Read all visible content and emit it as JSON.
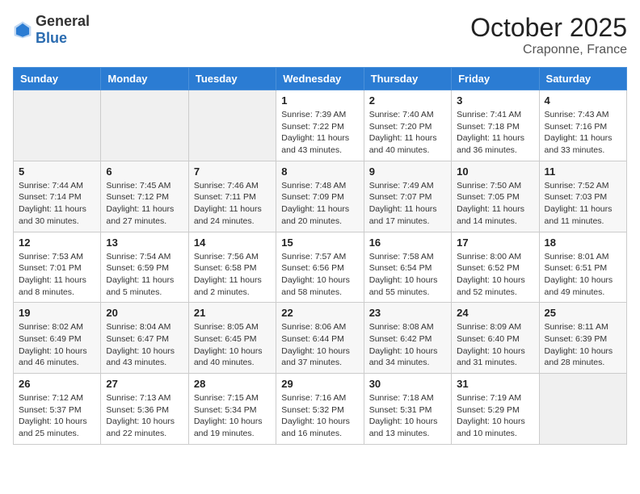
{
  "header": {
    "logo": {
      "general": "General",
      "blue": "Blue"
    },
    "title": "October 2025",
    "location": "Craponne, France"
  },
  "calendar": {
    "days_of_week": [
      "Sunday",
      "Monday",
      "Tuesday",
      "Wednesday",
      "Thursday",
      "Friday",
      "Saturday"
    ],
    "weeks": [
      [
        {
          "day": "",
          "info": ""
        },
        {
          "day": "",
          "info": ""
        },
        {
          "day": "",
          "info": ""
        },
        {
          "day": "1",
          "sunrise": "Sunrise: 7:39 AM",
          "sunset": "Sunset: 7:22 PM",
          "daylight": "Daylight: 11 hours and 43 minutes."
        },
        {
          "day": "2",
          "sunrise": "Sunrise: 7:40 AM",
          "sunset": "Sunset: 7:20 PM",
          "daylight": "Daylight: 11 hours and 40 minutes."
        },
        {
          "day": "3",
          "sunrise": "Sunrise: 7:41 AM",
          "sunset": "Sunset: 7:18 PM",
          "daylight": "Daylight: 11 hours and 36 minutes."
        },
        {
          "day": "4",
          "sunrise": "Sunrise: 7:43 AM",
          "sunset": "Sunset: 7:16 PM",
          "daylight": "Daylight: 11 hours and 33 minutes."
        }
      ],
      [
        {
          "day": "5",
          "sunrise": "Sunrise: 7:44 AM",
          "sunset": "Sunset: 7:14 PM",
          "daylight": "Daylight: 11 hours and 30 minutes."
        },
        {
          "day": "6",
          "sunrise": "Sunrise: 7:45 AM",
          "sunset": "Sunset: 7:12 PM",
          "daylight": "Daylight: 11 hours and 27 minutes."
        },
        {
          "day": "7",
          "sunrise": "Sunrise: 7:46 AM",
          "sunset": "Sunset: 7:11 PM",
          "daylight": "Daylight: 11 hours and 24 minutes."
        },
        {
          "day": "8",
          "sunrise": "Sunrise: 7:48 AM",
          "sunset": "Sunset: 7:09 PM",
          "daylight": "Daylight: 11 hours and 20 minutes."
        },
        {
          "day": "9",
          "sunrise": "Sunrise: 7:49 AM",
          "sunset": "Sunset: 7:07 PM",
          "daylight": "Daylight: 11 hours and 17 minutes."
        },
        {
          "day": "10",
          "sunrise": "Sunrise: 7:50 AM",
          "sunset": "Sunset: 7:05 PM",
          "daylight": "Daylight: 11 hours and 14 minutes."
        },
        {
          "day": "11",
          "sunrise": "Sunrise: 7:52 AM",
          "sunset": "Sunset: 7:03 PM",
          "daylight": "Daylight: 11 hours and 11 minutes."
        }
      ],
      [
        {
          "day": "12",
          "sunrise": "Sunrise: 7:53 AM",
          "sunset": "Sunset: 7:01 PM",
          "daylight": "Daylight: 11 hours and 8 minutes."
        },
        {
          "day": "13",
          "sunrise": "Sunrise: 7:54 AM",
          "sunset": "Sunset: 6:59 PM",
          "daylight": "Daylight: 11 hours and 5 minutes."
        },
        {
          "day": "14",
          "sunrise": "Sunrise: 7:56 AM",
          "sunset": "Sunset: 6:58 PM",
          "daylight": "Daylight: 11 hours and 2 minutes."
        },
        {
          "day": "15",
          "sunrise": "Sunrise: 7:57 AM",
          "sunset": "Sunset: 6:56 PM",
          "daylight": "Daylight: 10 hours and 58 minutes."
        },
        {
          "day": "16",
          "sunrise": "Sunrise: 7:58 AM",
          "sunset": "Sunset: 6:54 PM",
          "daylight": "Daylight: 10 hours and 55 minutes."
        },
        {
          "day": "17",
          "sunrise": "Sunrise: 8:00 AM",
          "sunset": "Sunset: 6:52 PM",
          "daylight": "Daylight: 10 hours and 52 minutes."
        },
        {
          "day": "18",
          "sunrise": "Sunrise: 8:01 AM",
          "sunset": "Sunset: 6:51 PM",
          "daylight": "Daylight: 10 hours and 49 minutes."
        }
      ],
      [
        {
          "day": "19",
          "sunrise": "Sunrise: 8:02 AM",
          "sunset": "Sunset: 6:49 PM",
          "daylight": "Daylight: 10 hours and 46 minutes."
        },
        {
          "day": "20",
          "sunrise": "Sunrise: 8:04 AM",
          "sunset": "Sunset: 6:47 PM",
          "daylight": "Daylight: 10 hours and 43 minutes."
        },
        {
          "day": "21",
          "sunrise": "Sunrise: 8:05 AM",
          "sunset": "Sunset: 6:45 PM",
          "daylight": "Daylight: 10 hours and 40 minutes."
        },
        {
          "day": "22",
          "sunrise": "Sunrise: 8:06 AM",
          "sunset": "Sunset: 6:44 PM",
          "daylight": "Daylight: 10 hours and 37 minutes."
        },
        {
          "day": "23",
          "sunrise": "Sunrise: 8:08 AM",
          "sunset": "Sunset: 6:42 PM",
          "daylight": "Daylight: 10 hours and 34 minutes."
        },
        {
          "day": "24",
          "sunrise": "Sunrise: 8:09 AM",
          "sunset": "Sunset: 6:40 PM",
          "daylight": "Daylight: 10 hours and 31 minutes."
        },
        {
          "day": "25",
          "sunrise": "Sunrise: 8:11 AM",
          "sunset": "Sunset: 6:39 PM",
          "daylight": "Daylight: 10 hours and 28 minutes."
        }
      ],
      [
        {
          "day": "26",
          "sunrise": "Sunrise: 7:12 AM",
          "sunset": "Sunset: 5:37 PM",
          "daylight": "Daylight: 10 hours and 25 minutes."
        },
        {
          "day": "27",
          "sunrise": "Sunrise: 7:13 AM",
          "sunset": "Sunset: 5:36 PM",
          "daylight": "Daylight: 10 hours and 22 minutes."
        },
        {
          "day": "28",
          "sunrise": "Sunrise: 7:15 AM",
          "sunset": "Sunset: 5:34 PM",
          "daylight": "Daylight: 10 hours and 19 minutes."
        },
        {
          "day": "29",
          "sunrise": "Sunrise: 7:16 AM",
          "sunset": "Sunset: 5:32 PM",
          "daylight": "Daylight: 10 hours and 16 minutes."
        },
        {
          "day": "30",
          "sunrise": "Sunrise: 7:18 AM",
          "sunset": "Sunset: 5:31 PM",
          "daylight": "Daylight: 10 hours and 13 minutes."
        },
        {
          "day": "31",
          "sunrise": "Sunrise: 7:19 AM",
          "sunset": "Sunset: 5:29 PM",
          "daylight": "Daylight: 10 hours and 10 minutes."
        },
        {
          "day": "",
          "info": ""
        }
      ]
    ]
  }
}
